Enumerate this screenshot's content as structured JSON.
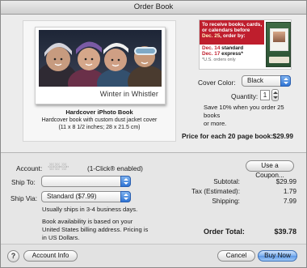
{
  "window": {
    "title": "Order Book"
  },
  "book": {
    "cover_text": "Winter in Whistler",
    "name": "Hardcover iPhoto Book",
    "desc_line1": "Hardcover book with custom dust jacket cover",
    "desc_line2": "(11 x 8 1/2 inches; 28 x 21.5 cm)"
  },
  "promo": {
    "line1": "To receive books, cards,",
    "line2": "or calendars before",
    "line3a": "Dec. 25",
    "line3b": ", order by:",
    "line4a": "Dec. 14",
    "line4b": " standard",
    "line5a": "Dec. 17",
    "line5b": " express*",
    "fine": "*U.S. orders only"
  },
  "options": {
    "cover_color_label": "Cover Color:",
    "cover_color_value": "Black",
    "quantity_label": "Quantity:",
    "quantity_value": "1",
    "discount_line1": "Save 10% when you order 25 books",
    "discount_line2": "or more.",
    "price_label": "Price for each 20 page book:",
    "price_value": "$29.99"
  },
  "account": {
    "label": "Account:",
    "masked": "∙░∙░∙∙░∙∙",
    "status": "(1-Click® enabled)",
    "coupon_button": "Use a Coupon..."
  },
  "shipping": {
    "ship_to_label": "Ship To:",
    "ship_to_value": "",
    "ship_via_label": "Ship Via:",
    "ship_via_value": "Standard ($7.99)",
    "note1": "Usually ships in 3-4 business days.",
    "note2": "Book availability is based on your",
    "note3": "United States billing address. Pricing is",
    "note4": "in US Dollars."
  },
  "totals": {
    "subtotal_label": "Subtotal:",
    "subtotal_value": "$29.99",
    "tax_label": "Tax (Estimated):",
    "tax_value": "1.79",
    "shipping_label": "Shipping:",
    "shipping_value": "7.99",
    "order_total_label": "Order Total:",
    "order_total_value": "$39.78"
  },
  "buttons": {
    "help": "?",
    "account_info": "Account Info",
    "cancel": "Cancel",
    "buy_now": "Buy Now"
  },
  "colors": {
    "accent_blue": "#2f74d4",
    "promo_red": "#bf1e2d"
  }
}
